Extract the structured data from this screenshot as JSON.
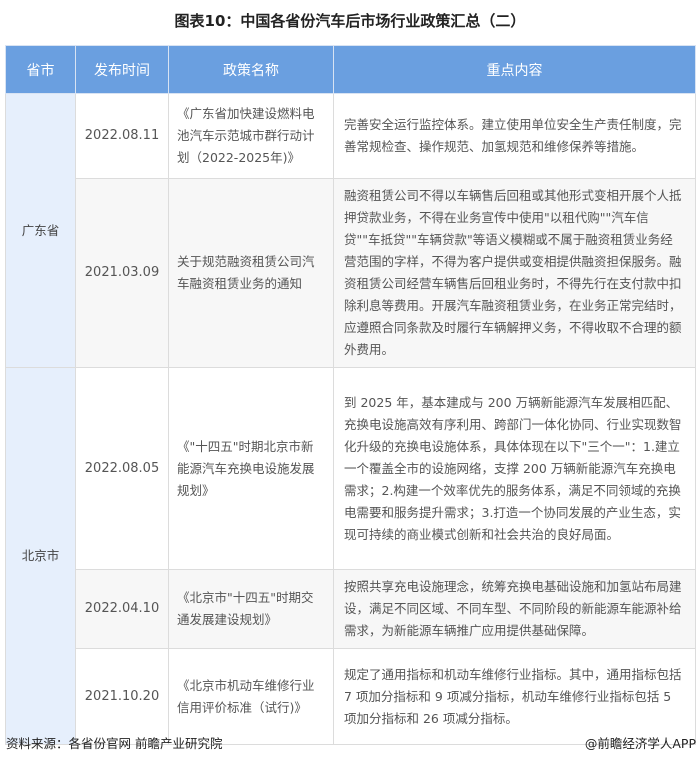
{
  "title": "图表10：中国各省份汽车后市场行业政策汇总（二）",
  "headers": [
    "省市",
    "发布时间",
    "政策名称",
    "重点内容"
  ],
  "provinces": [
    "广东省",
    "北京市"
  ],
  "rows": [
    {
      "date": "2022.08.11",
      "name": "《广东省加快建设燃料电池汽车示范城市群行动计划（2022-2025年)》",
      "content": "完善安全运行监控体系。建立使用单位安全生产责任制度，完善常规检查、操作规范、加氢规范和维修保养等措施。"
    },
    {
      "date": "2021.03.09",
      "name": "关于规范融资租赁公司汽车融资租赁业务的通知",
      "content": "融资租赁公司不得以车辆售后回租或其他形式变相开展个人抵押贷款业务，不得在业务宣传中使用\"以租代购\"\"汽车信贷\"\"车抵贷\"\"车辆贷款\"等语义模糊或不属于融资租赁业务经营范围的字样，不得为客户提供或变相提供融资担保服务。融资租赁公司经营车辆售后回租业务时，不得先行在支付款中扣除利息等费用。开展汽车融资租赁业务，在业务正常完结时，应遵照合同条款及时履行车辆解押义务，不得收取不合理的额外费用。"
    },
    {
      "date": "2022.08.05",
      "name": "《\"十四五\"时期北京市新能源汽车充换电设施发展规划》",
      "content": "到 2025 年，基本建成与 200 万辆新能源汽车发展相匹配、充换电设施高效有序利用、跨部门一体化协同、行业实现数智化升级的充换电设施体系，具体体现在以下\"三个一\"：1.建立一个覆盖全市的设施网络，支撑 200 万辆新能源汽车充换电需求；2.构建一个效率优先的服务体系，满足不同领域的充换电需要和服务提升需求；3.打造一个协同发展的产业生态，实现可持续的商业模式创新和社会共治的良好局面。"
    },
    {
      "date": "2022.04.10",
      "name": "《北京市\"十四五\"时期交通发展建设规划》",
      "content": "按照共享充电设施理念，统筹充换电基础设施和加氢站布局建设，满足不同区域、不同车型、不同阶段的新能源车能源补给需求，为新能源车辆推广应用提供基础保障。"
    },
    {
      "date": "2021.10.20",
      "name": "《北京市机动车维修行业信用评价标准（试行)》",
      "content": "规定了通用指标和机动车维修行业指标。其中，通用指标包括 7 项加分指标和 9 项减分指标，机动车维修行业指标包括 5 项加分指标和 26 项减分指标。"
    }
  ],
  "footer": {
    "source": "资料来源：各省份官网 前瞻产业研究院",
    "credit": "@前瞻经济学人APP"
  }
}
